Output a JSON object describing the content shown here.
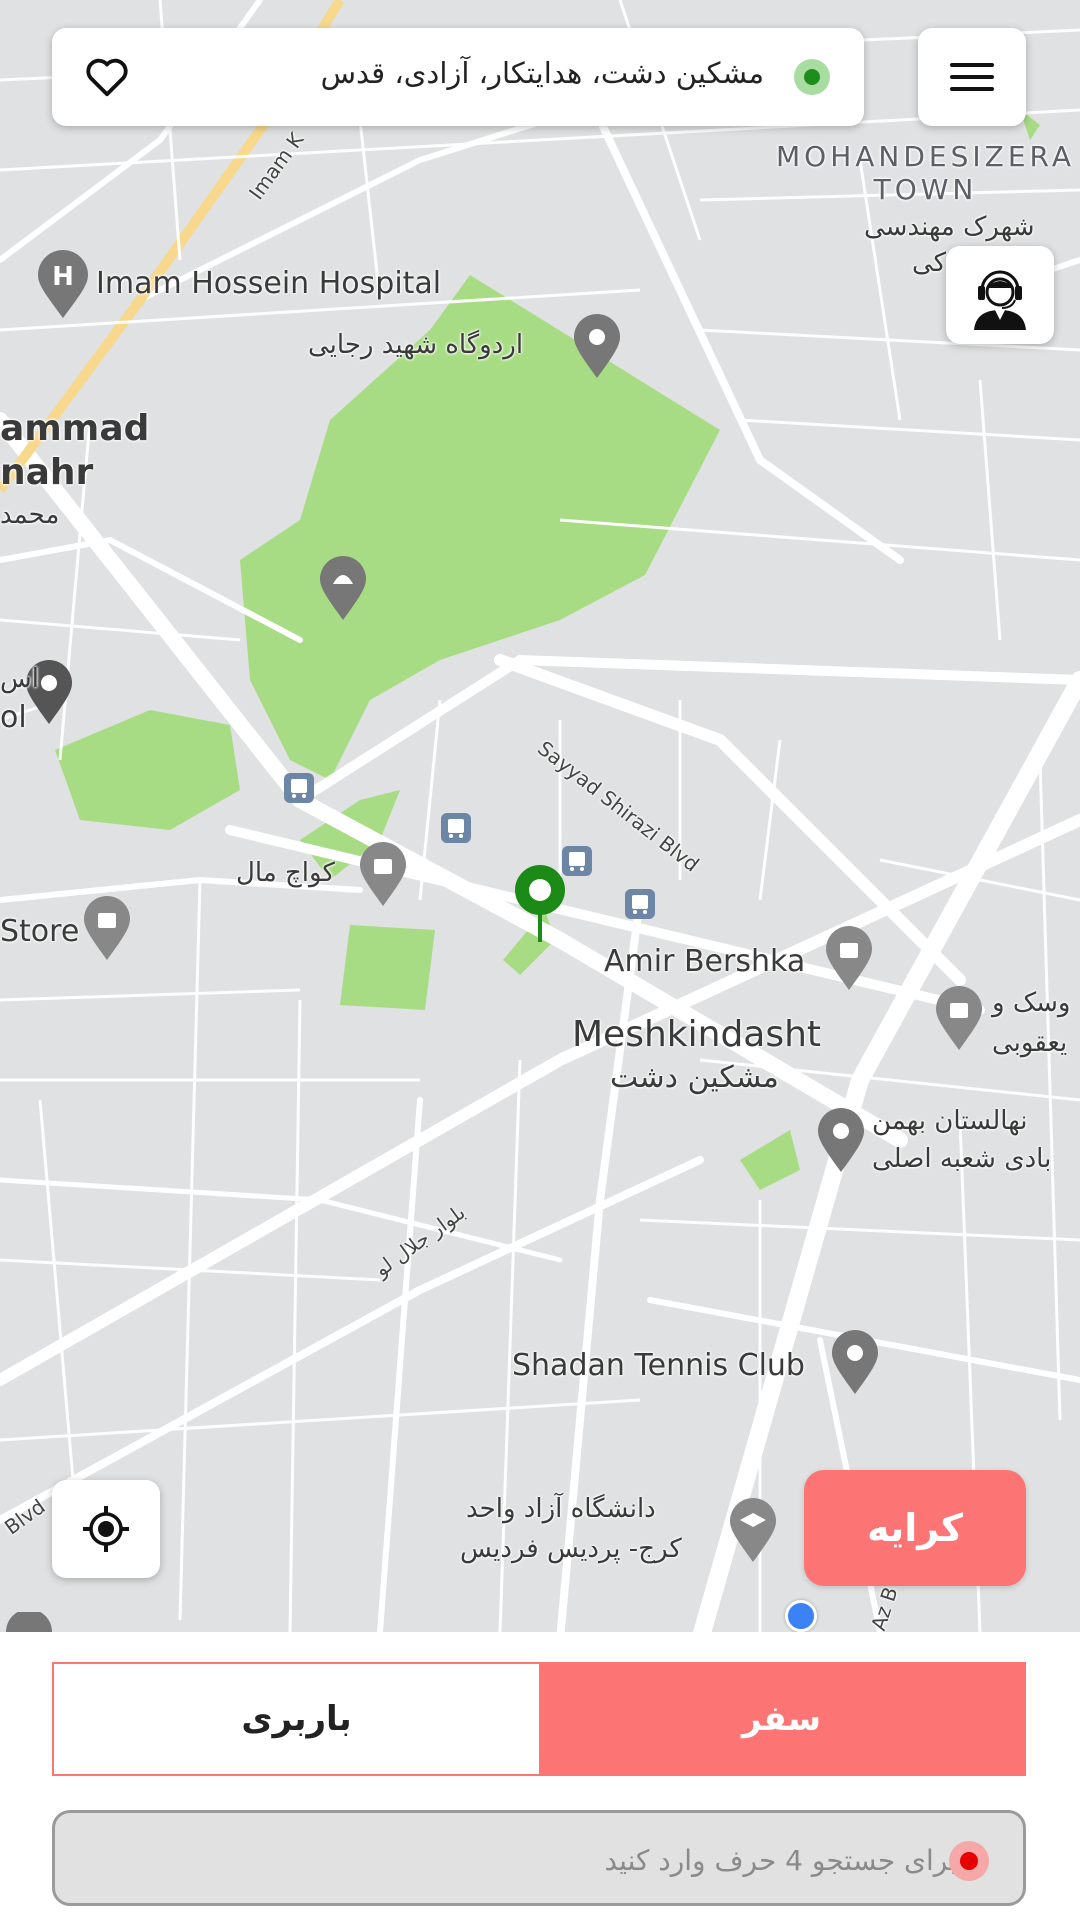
{
  "header": {
    "address": "مشکین دشت، هدایتکار، آزادی، قدس",
    "favorite_icon": "heart-outline-icon",
    "menu_icon": "hamburger-menu-icon",
    "status_color": "#1f8d1d"
  },
  "support": {
    "icon": "support-agent-icon"
  },
  "map": {
    "district": [
      "MOHANDESIZERA",
      "TOWN"
    ],
    "district_fa": "شهرک مهندسی",
    "district_fa_partial": "کی",
    "hospital": "Imam Hossein Hospital",
    "camp": "اردوگاه شهید رجایی",
    "mohammad_en": [
      "ammad",
      "nahr"
    ],
    "mohammad_fa": "محمد",
    "left_fa": "اس",
    "left_en": "ol",
    "koach_mall": "کواچ مال",
    "store": "Store",
    "amir_bershka": "Amir Bershka",
    "meshkindasht_en": "Meshkindasht",
    "meshkindasht_fa": "مشکین دشت",
    "yosk": [
      "وسک و",
      "یعقوبی"
    ],
    "bahman": [
      "نهالستان بهمن",
      "بادی شعبه اصلی"
    ],
    "shadan": "Shadan Tennis Club",
    "azad_univ": [
      "دانشگاه آزاد واحد",
      "کرج- پردیس فردیس"
    ],
    "road_sayyad": "Sayyad Shirazi Blvd",
    "road_jalal": "بلوار جلال لو",
    "road_imam": "Imam K",
    "road_blvd": "Blvd",
    "road_az": "Az B"
  },
  "buttons": {
    "fare": "کرایه",
    "locate_icon": "my-location-icon"
  },
  "tabs": {
    "trip": "سفر",
    "cargo": "باربری",
    "active": "trip"
  },
  "search": {
    "placeholder": "برای جستجو 4 حرف وارد کنید",
    "value": ""
  },
  "colors": {
    "accent": "#fc7474",
    "park": "#a8dc84",
    "map_bg": "#dfe1e2",
    "pin": "#1c8a16",
    "user_location": "#3b82f6"
  }
}
